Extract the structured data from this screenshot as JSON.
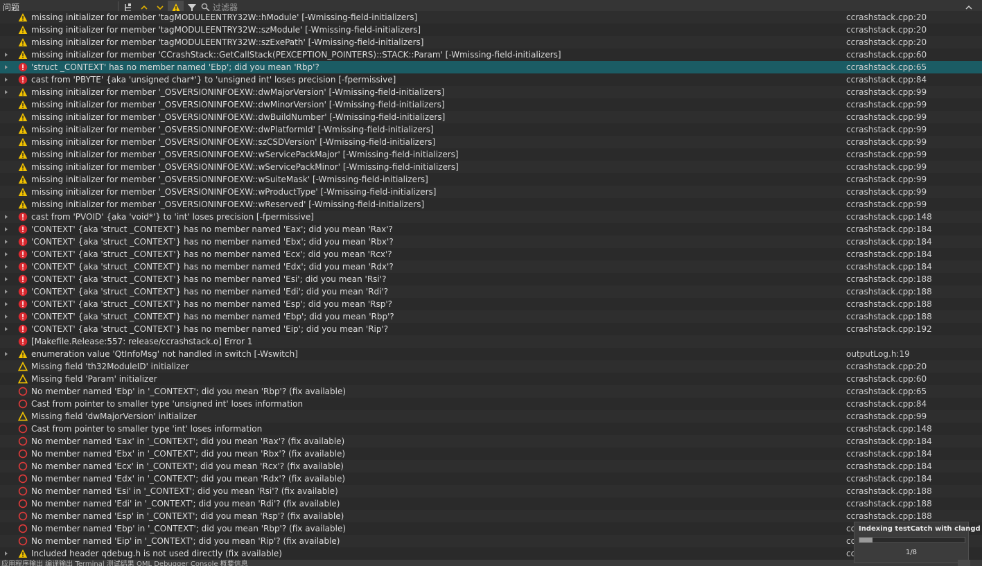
{
  "toolbar": {
    "title": "问题",
    "filter_placeholder": "过滤器"
  },
  "status": {
    "text": "应用程序输出  编译输出  Terminal  测试结果  QML Debugger Console  概要信息"
  },
  "progress": {
    "title": "Indexing testCatch with clangd",
    "counter": "1/8",
    "fraction": 0.125
  },
  "rows": [
    {
      "type": "warning",
      "exp": false,
      "msg": "missing initializer for member 'tagMODULEENTRY32W::hModule' [-Wmissing-field-initializers]",
      "loc": "ccrashstack.cpp:20"
    },
    {
      "type": "warning",
      "exp": false,
      "msg": "missing initializer for member 'tagMODULEENTRY32W::szModule' [-Wmissing-field-initializers]",
      "loc": "ccrashstack.cpp:20"
    },
    {
      "type": "warning",
      "exp": false,
      "msg": "missing initializer for member 'tagMODULEENTRY32W::szExePath' [-Wmissing-field-initializers]",
      "loc": "ccrashstack.cpp:20"
    },
    {
      "type": "warning",
      "exp": true,
      "msg": "missing initializer for member 'CCrashStack::GetCallStack(PEXCEPTION_POINTERS)::STACK::Param' [-Wmissing-field-initializers]",
      "loc": "ccrashstack.cpp:60"
    },
    {
      "type": "error",
      "exp": true,
      "selected": true,
      "msg": "'struct _CONTEXT' has no member named 'Ebp'; did you mean 'Rbp'?",
      "loc": "ccrashstack.cpp:65"
    },
    {
      "type": "error",
      "exp": true,
      "msg": "cast from 'PBYTE' {aka 'unsigned char*'} to 'unsigned int' loses precision [-fpermissive]",
      "loc": "ccrashstack.cpp:84"
    },
    {
      "type": "warning",
      "exp": true,
      "msg": "missing initializer for member '_OSVERSIONINFOEXW::dwMajorVersion' [-Wmissing-field-initializers]",
      "loc": "ccrashstack.cpp:99"
    },
    {
      "type": "warning",
      "exp": false,
      "msg": "missing initializer for member '_OSVERSIONINFOEXW::dwMinorVersion' [-Wmissing-field-initializers]",
      "loc": "ccrashstack.cpp:99"
    },
    {
      "type": "warning",
      "exp": false,
      "msg": "missing initializer for member '_OSVERSIONINFOEXW::dwBuildNumber' [-Wmissing-field-initializers]",
      "loc": "ccrashstack.cpp:99"
    },
    {
      "type": "warning",
      "exp": false,
      "msg": "missing initializer for member '_OSVERSIONINFOEXW::dwPlatformId' [-Wmissing-field-initializers]",
      "loc": "ccrashstack.cpp:99"
    },
    {
      "type": "warning",
      "exp": false,
      "msg": "missing initializer for member '_OSVERSIONINFOEXW::szCSDVersion' [-Wmissing-field-initializers]",
      "loc": "ccrashstack.cpp:99"
    },
    {
      "type": "warning",
      "exp": false,
      "msg": "missing initializer for member '_OSVERSIONINFOEXW::wServicePackMajor' [-Wmissing-field-initializers]",
      "loc": "ccrashstack.cpp:99"
    },
    {
      "type": "warning",
      "exp": false,
      "msg": "missing initializer for member '_OSVERSIONINFOEXW::wServicePackMinor' [-Wmissing-field-initializers]",
      "loc": "ccrashstack.cpp:99"
    },
    {
      "type": "warning",
      "exp": false,
      "msg": "missing initializer for member '_OSVERSIONINFOEXW::wSuiteMask' [-Wmissing-field-initializers]",
      "loc": "ccrashstack.cpp:99"
    },
    {
      "type": "warning",
      "exp": false,
      "msg": "missing initializer for member '_OSVERSIONINFOEXW::wProductType' [-Wmissing-field-initializers]",
      "loc": "ccrashstack.cpp:99"
    },
    {
      "type": "warning",
      "exp": false,
      "msg": "missing initializer for member '_OSVERSIONINFOEXW::wReserved' [-Wmissing-field-initializers]",
      "loc": "ccrashstack.cpp:99"
    },
    {
      "type": "error",
      "exp": true,
      "msg": "cast from 'PVOID' {aka 'void*'} to 'int' loses precision [-fpermissive]",
      "loc": "ccrashstack.cpp:148"
    },
    {
      "type": "error",
      "exp": true,
      "msg": "'CONTEXT' {aka 'struct _CONTEXT'} has no member named 'Eax'; did you mean 'Rax'?",
      "loc": "ccrashstack.cpp:184"
    },
    {
      "type": "error",
      "exp": true,
      "msg": "'CONTEXT' {aka 'struct _CONTEXT'} has no member named 'Ebx'; did you mean 'Rbx'?",
      "loc": "ccrashstack.cpp:184"
    },
    {
      "type": "error",
      "exp": true,
      "msg": "'CONTEXT' {aka 'struct _CONTEXT'} has no member named 'Ecx'; did you mean 'Rcx'?",
      "loc": "ccrashstack.cpp:184"
    },
    {
      "type": "error",
      "exp": true,
      "msg": "'CONTEXT' {aka 'struct _CONTEXT'} has no member named 'Edx'; did you mean 'Rdx'?",
      "loc": "ccrashstack.cpp:184"
    },
    {
      "type": "error",
      "exp": true,
      "msg": "'CONTEXT' {aka 'struct _CONTEXT'} has no member named 'Esi'; did you mean 'Rsi'?",
      "loc": "ccrashstack.cpp:188"
    },
    {
      "type": "error",
      "exp": true,
      "msg": "'CONTEXT' {aka 'struct _CONTEXT'} has no member named 'Edi'; did you mean 'Rdi'?",
      "loc": "ccrashstack.cpp:188"
    },
    {
      "type": "error",
      "exp": true,
      "msg": "'CONTEXT' {aka 'struct _CONTEXT'} has no member named 'Esp'; did you mean 'Rsp'?",
      "loc": "ccrashstack.cpp:188"
    },
    {
      "type": "error",
      "exp": true,
      "msg": "'CONTEXT' {aka 'struct _CONTEXT'} has no member named 'Ebp'; did you mean 'Rbp'?",
      "loc": "ccrashstack.cpp:188"
    },
    {
      "type": "error",
      "exp": true,
      "msg": "'CONTEXT' {aka 'struct _CONTEXT'} has no member named 'Eip'; did you mean 'Rip'?",
      "loc": "ccrashstack.cpp:192"
    },
    {
      "type": "error",
      "exp": false,
      "msg": "[Makefile.Release:557: release/ccrashstack.o] Error 1",
      "loc": ""
    },
    {
      "type": "warning",
      "exp": true,
      "msg": "enumeration value 'QtInfoMsg' not handled in switch [-Wswitch]",
      "loc": "outputLog.h:19"
    },
    {
      "type": "warning-outline",
      "exp": false,
      "msg": "Missing field 'th32ModuleID' initializer",
      "loc": "ccrashstack.cpp:20"
    },
    {
      "type": "warning-outline",
      "exp": false,
      "msg": "Missing field 'Param' initializer",
      "loc": "ccrashstack.cpp:60"
    },
    {
      "type": "error-outline",
      "exp": false,
      "msg": "No member named 'Ebp' in '_CONTEXT'; did you mean 'Rbp'? (fix available)",
      "loc": "ccrashstack.cpp:65"
    },
    {
      "type": "error-outline",
      "exp": false,
      "msg": "Cast from pointer to smaller type 'unsigned int' loses information",
      "loc": "ccrashstack.cpp:84"
    },
    {
      "type": "warning-outline",
      "exp": false,
      "msg": "Missing field 'dwMajorVersion' initializer",
      "loc": "ccrashstack.cpp:99"
    },
    {
      "type": "error-outline",
      "exp": false,
      "msg": "Cast from pointer to smaller type 'int' loses information",
      "loc": "ccrashstack.cpp:148"
    },
    {
      "type": "error-outline",
      "exp": false,
      "msg": "No member named 'Eax' in '_CONTEXT'; did you mean 'Rax'? (fix available)",
      "loc": "ccrashstack.cpp:184"
    },
    {
      "type": "error-outline",
      "exp": false,
      "msg": "No member named 'Ebx' in '_CONTEXT'; did you mean 'Rbx'? (fix available)",
      "loc": "ccrashstack.cpp:184"
    },
    {
      "type": "error-outline",
      "exp": false,
      "msg": "No member named 'Ecx' in '_CONTEXT'; did you mean 'Rcx'? (fix available)",
      "loc": "ccrashstack.cpp:184"
    },
    {
      "type": "error-outline",
      "exp": false,
      "msg": "No member named 'Edx' in '_CONTEXT'; did you mean 'Rdx'? (fix available)",
      "loc": "ccrashstack.cpp:184"
    },
    {
      "type": "error-outline",
      "exp": false,
      "msg": "No member named 'Esi' in '_CONTEXT'; did you mean 'Rsi'? (fix available)",
      "loc": "ccrashstack.cpp:188"
    },
    {
      "type": "error-outline",
      "exp": false,
      "msg": "No member named 'Edi' in '_CONTEXT'; did you mean 'Rdi'? (fix available)",
      "loc": "ccrashstack.cpp:188"
    },
    {
      "type": "error-outline",
      "exp": false,
      "msg": "No member named 'Esp' in '_CONTEXT'; did you mean 'Rsp'? (fix available)",
      "loc": "ccrashstack.cpp:188"
    },
    {
      "type": "error-outline",
      "exp": false,
      "msg": "No member named 'Ebp' in '_CONTEXT'; did you mean 'Rbp'? (fix available)",
      "loc": "cc"
    },
    {
      "type": "error-outline",
      "exp": false,
      "msg": "No member named 'Eip' in '_CONTEXT'; did you mean 'Rip'? (fix available)",
      "loc": "cc"
    },
    {
      "type": "warning",
      "exp": true,
      "msg": "Included header qdebug.h is not used directly (fix available)",
      "loc": "cc"
    }
  ]
}
